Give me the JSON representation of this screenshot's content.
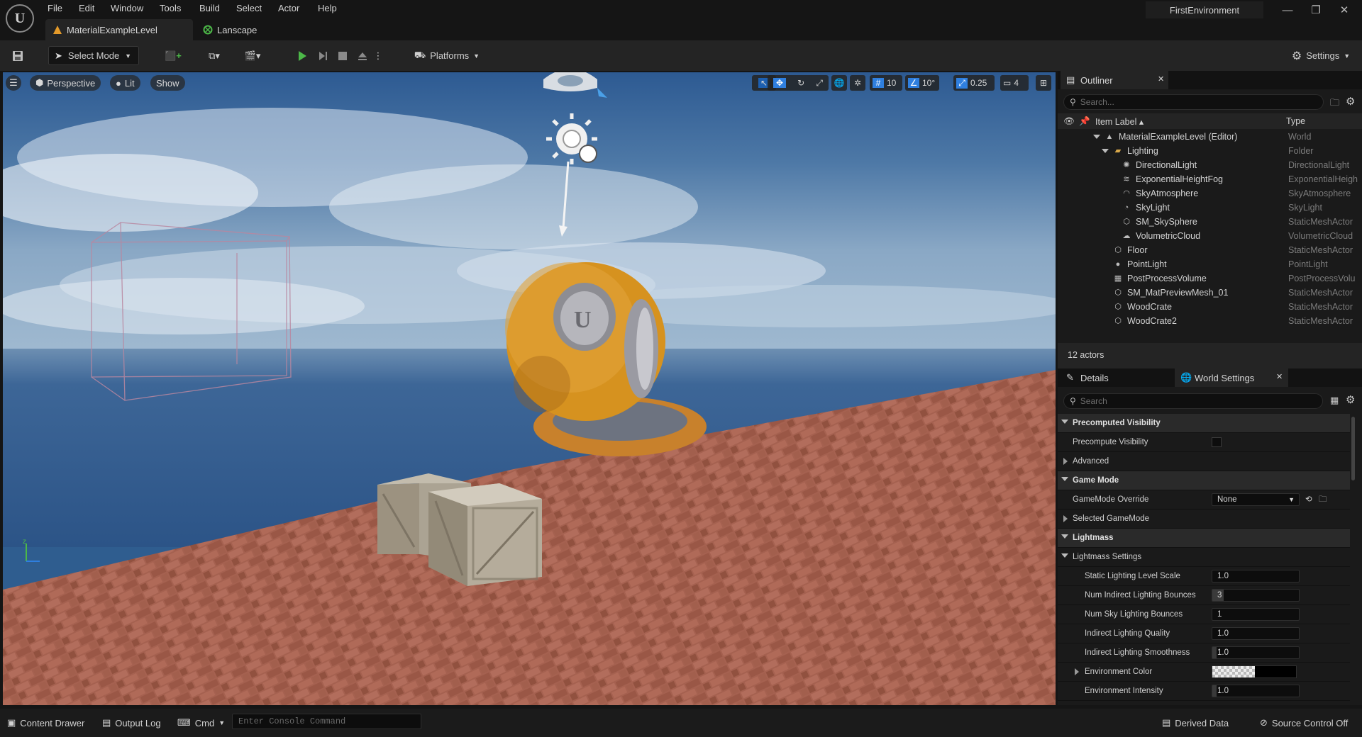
{
  "menu": [
    "File",
    "Edit",
    "Window",
    "Tools",
    "Build",
    "Select",
    "Actor",
    "Help"
  ],
  "tabs": {
    "level": "MaterialExampleLevel",
    "landscape": "Lanscape"
  },
  "project_name": "FirstEnvironment",
  "toolbar": {
    "select_mode": "Select Mode",
    "platforms": "Platforms",
    "settings": "Settings"
  },
  "viewport": {
    "perspective": "Perspective",
    "lit": "Lit",
    "show": "Show",
    "grid_snap": "10",
    "rot_snap": "10°",
    "scale_snap": "0.25",
    "cam_speed": "4"
  },
  "outliner": {
    "title": "Outliner",
    "search_placeholder": "Search...",
    "col_label": "Item Label ▴",
    "col_type": "Type",
    "items": [
      {
        "label": "MaterialExampleLevel (Editor)",
        "type": "World",
        "icon": "level-icon"
      },
      {
        "label": "Lighting",
        "type": "Folder",
        "icon": "folder-icon"
      },
      {
        "label": "DirectionalLight",
        "type": "DirectionalLight",
        "icon": "sun-icon"
      },
      {
        "label": "ExponentialHeightFog",
        "type": "ExponentialHeigh",
        "icon": "fog-icon"
      },
      {
        "label": "SkyAtmosphere",
        "type": "SkyAtmosphere",
        "icon": "atmosphere-icon"
      },
      {
        "label": "SkyLight",
        "type": "SkyLight",
        "icon": "skylight-icon"
      },
      {
        "label": "SM_SkySphere",
        "type": "StaticMeshActor",
        "icon": "mesh-icon"
      },
      {
        "label": "VolumetricCloud",
        "type": "VolumetricCloud",
        "icon": "cloud-icon"
      },
      {
        "label": "Floor",
        "type": "StaticMeshActor",
        "icon": "mesh-icon"
      },
      {
        "label": "PointLight",
        "type": "PointLight",
        "icon": "bulb-icon"
      },
      {
        "label": "PostProcessVolume",
        "type": "PostProcessVolu",
        "icon": "volume-icon"
      },
      {
        "label": "SM_MatPreviewMesh_01",
        "type": "StaticMeshActor",
        "icon": "mesh-icon"
      },
      {
        "label": "WoodCrate",
        "type": "StaticMeshActor",
        "icon": "mesh-icon"
      },
      {
        "label": "WoodCrate2",
        "type": "StaticMeshActor",
        "icon": "mesh-icon"
      }
    ],
    "actor_count": "12 actors"
  },
  "details": {
    "tab_details": "Details",
    "tab_world": "World Settings",
    "search_placeholder": "Search",
    "rows": {
      "precomputed_visibility": "Precomputed Visibility",
      "precompute_visibility": "Precompute Visibility",
      "advanced": "Advanced",
      "game_mode": "Game Mode",
      "gamemode_override": "GameMode Override",
      "gamemode_value": "None",
      "selected_gamemode": "Selected GameMode",
      "lightmass": "Lightmass",
      "lightmass_settings": "Lightmass Settings",
      "static_scale": "Static Lighting Level Scale",
      "static_scale_val": "1.0",
      "num_indirect": "Num Indirect Lighting Bounces",
      "num_indirect_val": "3",
      "num_sky": "Num Sky Lighting Bounces",
      "num_sky_val": "1",
      "indirect_quality": "Indirect Lighting Quality",
      "indirect_quality_val": "1.0",
      "indirect_smooth": "Indirect Lighting Smoothness",
      "indirect_smooth_val": "1.0",
      "env_color": "Environment Color",
      "env_intensity": "Environment Intensity",
      "env_intensity_val": "1.0"
    }
  },
  "status": {
    "content_drawer": "Content Drawer",
    "output_log": "Output Log",
    "cmd": "Cmd",
    "console_placeholder": "Enter Console Command",
    "derived_data": "Derived Data",
    "source_control": "Source Control Off"
  },
  "colors": {
    "accent": "#2f7fdf",
    "play": "#4cb848",
    "panel": "#1a1a1a",
    "toolbar": "#242424"
  }
}
